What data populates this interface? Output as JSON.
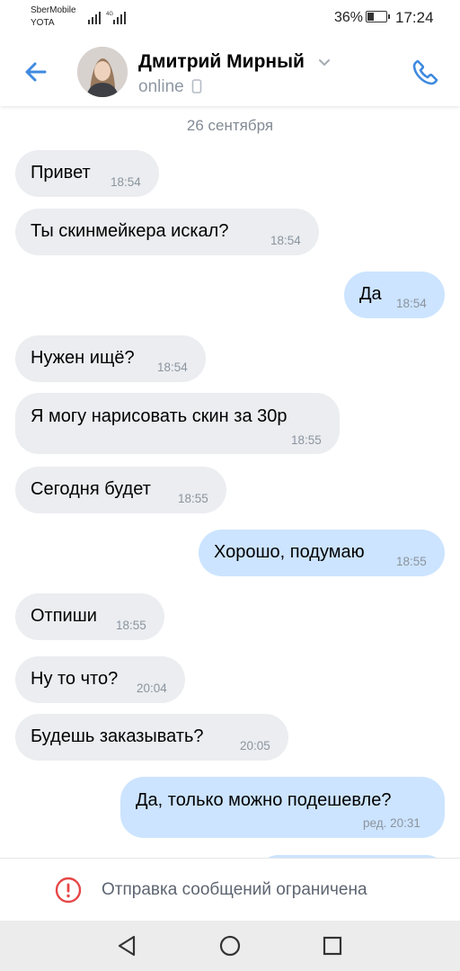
{
  "status_bar": {
    "carrier_1": "SberMobile",
    "carrier_2": "YOTA",
    "battery_percent": "36%",
    "battery_level": 0.36,
    "time": "17:24"
  },
  "header": {
    "contact_name": "Дмитрий Мирный",
    "status": "online",
    "accent_color": "#3f8ae0"
  },
  "chat": {
    "date_separator": "26 сентября",
    "messages": [
      {
        "dir": "in",
        "text": "Привет",
        "time": "18:54"
      },
      {
        "dir": "in",
        "text": "Ты скинмейкера искал?",
        "time": "18:54"
      },
      {
        "dir": "out",
        "text": "Да",
        "time": "18:54"
      },
      {
        "dir": "in",
        "text": "Нужен ищё?",
        "time": "18:54"
      },
      {
        "dir": "in",
        "text": "Я могу нарисовать скин за 30р",
        "time": "18:55"
      },
      {
        "dir": "in",
        "text": "Сегодня будет",
        "time": "18:55"
      },
      {
        "dir": "out",
        "text": "Хорошо, подумаю",
        "time": "18:55"
      },
      {
        "dir": "in",
        "text": "Отпиши",
        "time": "18:55"
      },
      {
        "dir": "in",
        "text": "Ну то что?",
        "time": "20:04"
      },
      {
        "dir": "in",
        "text": "Будешь заказывать?",
        "time": "20:05"
      },
      {
        "dir": "out",
        "text": "Да, только можно подешевле?",
        "time": "ред. 20:31"
      }
    ]
  },
  "restriction": {
    "text": "Отправка сообщений ограничена",
    "icon": "alert-circle-icon",
    "icon_color": "#e64646"
  },
  "nav_bar": {
    "icons": [
      "back-triangle-icon",
      "home-circle-icon",
      "recents-square-icon"
    ]
  }
}
